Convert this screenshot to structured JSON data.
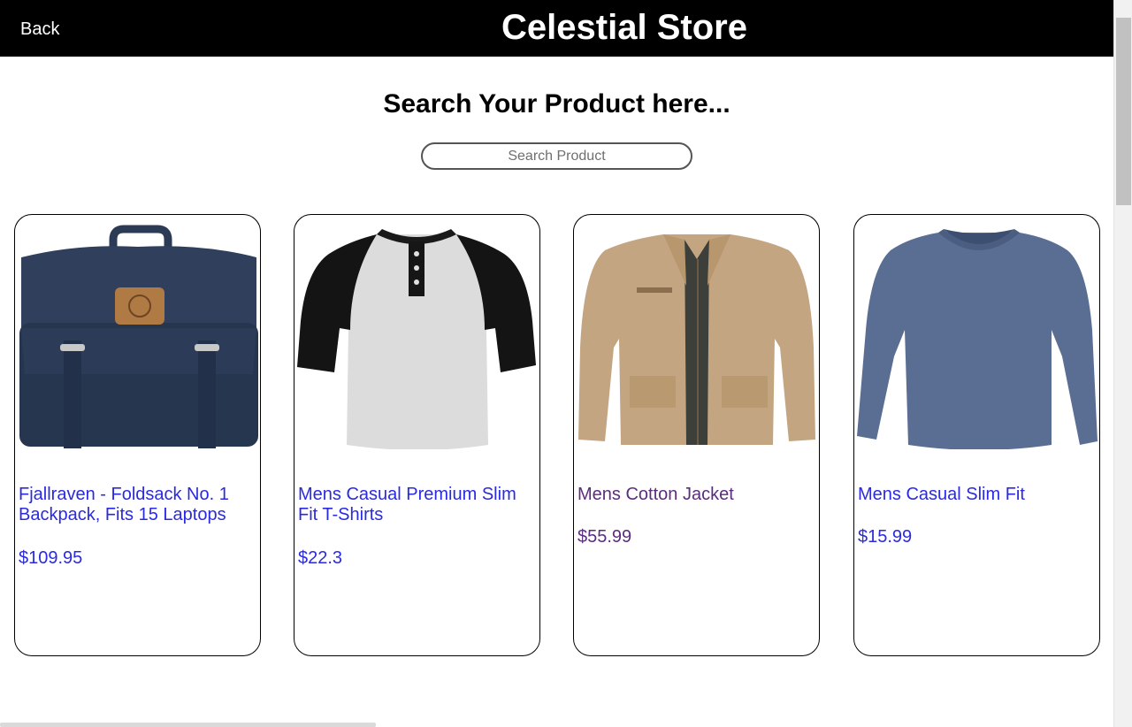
{
  "header": {
    "back_label": "Back",
    "store_title": "Celestial Store"
  },
  "search": {
    "heading": "Search Your Product here...",
    "placeholder": "Search Product",
    "value": ""
  },
  "products": [
    {
      "name": "Fjallraven - Foldsack No. 1 Backpack, Fits 15 Laptops",
      "price": "$109.95",
      "image": "backpack",
      "visited": false
    },
    {
      "name": "Mens Casual Premium Slim Fit T-Shirts",
      "price": "$22.3",
      "image": "raglan-henley-tshirt",
      "visited": false
    },
    {
      "name": "Mens Cotton Jacket",
      "price": "$55.99",
      "image": "khaki-cotton-jacket",
      "visited": true
    },
    {
      "name": "Mens Casual Slim Fit",
      "price": "$15.99",
      "image": "blue-long-sleeve-tee",
      "visited": false
    }
  ],
  "colors": {
    "header_bg": "#000000",
    "link": "#2a2ae0",
    "visited_link": "#5b2c7f"
  }
}
